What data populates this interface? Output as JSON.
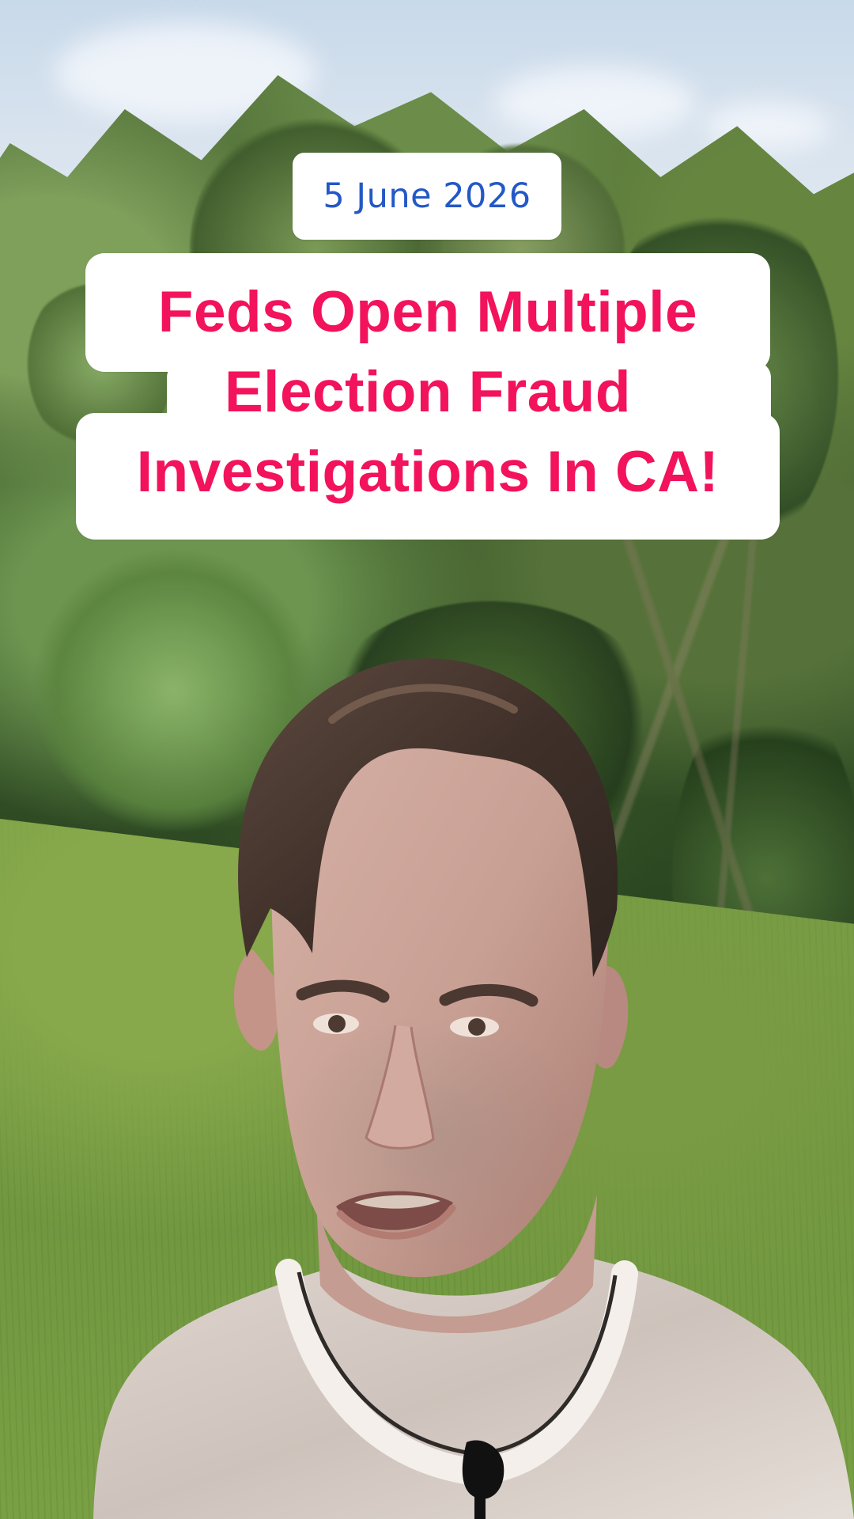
{
  "overlay": {
    "date": "5 June 2026",
    "headline_lines": [
      "Feds Open Multiple",
      "Election Fraud",
      "Investigations In CA!"
    ]
  },
  "colors": {
    "date_text": "#2358C6",
    "headline_text": "#F2135C",
    "label_background": "#FFFFFF"
  }
}
